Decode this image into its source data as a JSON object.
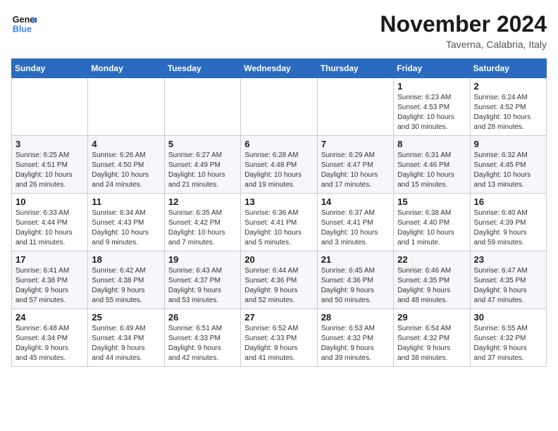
{
  "logo": {
    "line1": "General",
    "line2": "Blue"
  },
  "header": {
    "month": "November 2024",
    "location": "Taverna, Calabria, Italy"
  },
  "weekdays": [
    "Sunday",
    "Monday",
    "Tuesday",
    "Wednesday",
    "Thursday",
    "Friday",
    "Saturday"
  ],
  "weeks": [
    [
      {
        "day": "",
        "info": ""
      },
      {
        "day": "",
        "info": ""
      },
      {
        "day": "",
        "info": ""
      },
      {
        "day": "",
        "info": ""
      },
      {
        "day": "",
        "info": ""
      },
      {
        "day": "1",
        "info": "Sunrise: 6:23 AM\nSunset: 4:53 PM\nDaylight: 10 hours\nand 30 minutes."
      },
      {
        "day": "2",
        "info": "Sunrise: 6:24 AM\nSunset: 4:52 PM\nDaylight: 10 hours\nand 28 minutes."
      }
    ],
    [
      {
        "day": "3",
        "info": "Sunrise: 6:25 AM\nSunset: 4:51 PM\nDaylight: 10 hours\nand 26 minutes."
      },
      {
        "day": "4",
        "info": "Sunrise: 6:26 AM\nSunset: 4:50 PM\nDaylight: 10 hours\nand 24 minutes."
      },
      {
        "day": "5",
        "info": "Sunrise: 6:27 AM\nSunset: 4:49 PM\nDaylight: 10 hours\nand 21 minutes."
      },
      {
        "day": "6",
        "info": "Sunrise: 6:28 AM\nSunset: 4:48 PM\nDaylight: 10 hours\nand 19 minutes."
      },
      {
        "day": "7",
        "info": "Sunrise: 6:29 AM\nSunset: 4:47 PM\nDaylight: 10 hours\nand 17 minutes."
      },
      {
        "day": "8",
        "info": "Sunrise: 6:31 AM\nSunset: 4:46 PM\nDaylight: 10 hours\nand 15 minutes."
      },
      {
        "day": "9",
        "info": "Sunrise: 6:32 AM\nSunset: 4:45 PM\nDaylight: 10 hours\nand 13 minutes."
      }
    ],
    [
      {
        "day": "10",
        "info": "Sunrise: 6:33 AM\nSunset: 4:44 PM\nDaylight: 10 hours\nand 11 minutes."
      },
      {
        "day": "11",
        "info": "Sunrise: 6:34 AM\nSunset: 4:43 PM\nDaylight: 10 hours\nand 9 minutes."
      },
      {
        "day": "12",
        "info": "Sunrise: 6:35 AM\nSunset: 4:42 PM\nDaylight: 10 hours\nand 7 minutes."
      },
      {
        "day": "13",
        "info": "Sunrise: 6:36 AM\nSunset: 4:41 PM\nDaylight: 10 hours\nand 5 minutes."
      },
      {
        "day": "14",
        "info": "Sunrise: 6:37 AM\nSunset: 4:41 PM\nDaylight: 10 hours\nand 3 minutes."
      },
      {
        "day": "15",
        "info": "Sunrise: 6:38 AM\nSunset: 4:40 PM\nDaylight: 10 hours\nand 1 minute."
      },
      {
        "day": "16",
        "info": "Sunrise: 6:40 AM\nSunset: 4:39 PM\nDaylight: 9 hours\nand 59 minutes."
      }
    ],
    [
      {
        "day": "17",
        "info": "Sunrise: 6:41 AM\nSunset: 4:38 PM\nDaylight: 9 hours\nand 57 minutes."
      },
      {
        "day": "18",
        "info": "Sunrise: 6:42 AM\nSunset: 4:38 PM\nDaylight: 9 hours\nand 55 minutes."
      },
      {
        "day": "19",
        "info": "Sunrise: 6:43 AM\nSunset: 4:37 PM\nDaylight: 9 hours\nand 53 minutes."
      },
      {
        "day": "20",
        "info": "Sunrise: 6:44 AM\nSunset: 4:36 PM\nDaylight: 9 hours\nand 52 minutes."
      },
      {
        "day": "21",
        "info": "Sunrise: 6:45 AM\nSunset: 4:36 PM\nDaylight: 9 hours\nand 50 minutes."
      },
      {
        "day": "22",
        "info": "Sunrise: 6:46 AM\nSunset: 4:35 PM\nDaylight: 9 hours\nand 48 minutes."
      },
      {
        "day": "23",
        "info": "Sunrise: 6:47 AM\nSunset: 4:35 PM\nDaylight: 9 hours\nand 47 minutes."
      }
    ],
    [
      {
        "day": "24",
        "info": "Sunrise: 6:48 AM\nSunset: 4:34 PM\nDaylight: 9 hours\nand 45 minutes."
      },
      {
        "day": "25",
        "info": "Sunrise: 6:49 AM\nSunset: 4:34 PM\nDaylight: 9 hours\nand 44 minutes."
      },
      {
        "day": "26",
        "info": "Sunrise: 6:51 AM\nSunset: 4:33 PM\nDaylight: 9 hours\nand 42 minutes."
      },
      {
        "day": "27",
        "info": "Sunrise: 6:52 AM\nSunset: 4:33 PM\nDaylight: 9 hours\nand 41 minutes."
      },
      {
        "day": "28",
        "info": "Sunrise: 6:53 AM\nSunset: 4:32 PM\nDaylight: 9 hours\nand 39 minutes."
      },
      {
        "day": "29",
        "info": "Sunrise: 6:54 AM\nSunset: 4:32 PM\nDaylight: 9 hours\nand 38 minutes."
      },
      {
        "day": "30",
        "info": "Sunrise: 6:55 AM\nSunset: 4:32 PM\nDaylight: 9 hours\nand 37 minutes."
      }
    ]
  ]
}
